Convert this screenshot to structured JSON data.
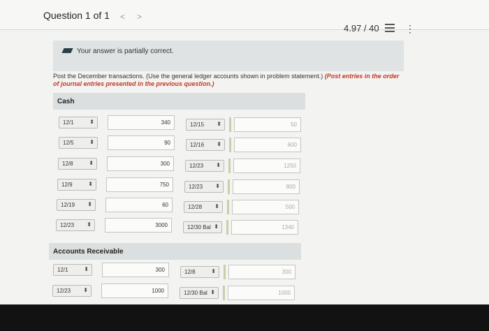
{
  "header": {
    "question_label": "Question 1 of 1",
    "prev_icon": "chevron-left-icon",
    "prev_glyph": "<",
    "next_icon": "chevron-right-icon",
    "next_glyph": ">",
    "score": "4.97 / 40",
    "list_icon": "list-icon",
    "more_icon": "more-vertical-icon",
    "more_glyph": "⋮"
  },
  "banner": {
    "icon": "pencil-icon",
    "message": "Your answer is partially correct."
  },
  "instructions": {
    "text": "Post the December transactions. (Use the general ledger accounts shown in problem statement.)",
    "emphasis": "(Post entries in the order of journal entries presented in the previous question.)"
  },
  "ledgers": {
    "cash": {
      "title": "Cash",
      "rows": [
        {
          "debit_date": "12/1",
          "debit_amount": "340",
          "credit_date": "12/15",
          "credit_amount": "50"
        },
        {
          "debit_date": "12/5",
          "debit_amount": "90",
          "credit_date": "12/16",
          "credit_amount": "600"
        },
        {
          "debit_date": "12/8",
          "debit_amount": "300",
          "credit_date": "12/23",
          "credit_amount": "1250"
        },
        {
          "debit_date": "12/9",
          "debit_amount": "750",
          "credit_date": "12/23",
          "credit_amount": "800"
        },
        {
          "debit_date": "12/19",
          "debit_amount": "60",
          "credit_date": "12/28",
          "credit_amount": "500"
        },
        {
          "debit_date": "12/23",
          "debit_amount": "3000",
          "credit_date": "12/30 Bal",
          "credit_amount": "1340"
        }
      ]
    },
    "accounts_receivable": {
      "title": "Accounts Receivable",
      "rows": [
        {
          "debit_date": "12/1",
          "debit_amount": "300",
          "credit_date": "12/8",
          "credit_amount": "300"
        },
        {
          "debit_date": "12/23",
          "debit_amount": "1000",
          "credit_date": "12/30 Bal",
          "credit_amount": "1000"
        }
      ]
    }
  },
  "ui": {
    "select_arrow": "⬍",
    "select_icon": "updown-arrow-icon"
  }
}
